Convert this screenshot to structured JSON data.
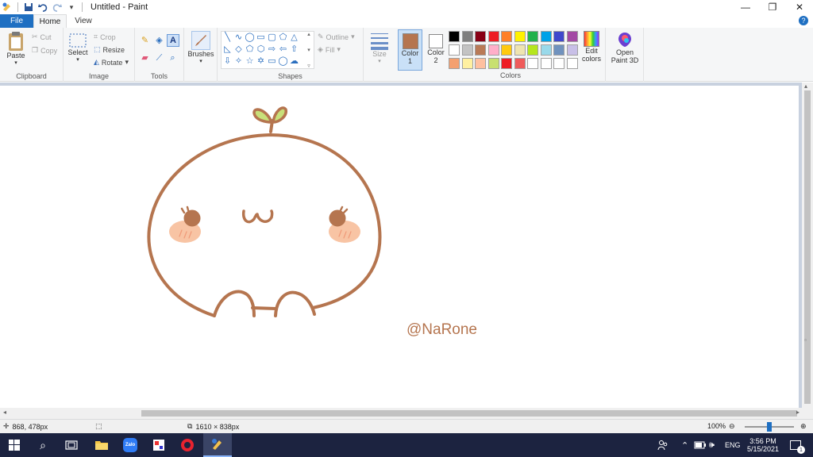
{
  "window": {
    "title": "Untitled - Paint"
  },
  "tabs": {
    "file": "File",
    "home": "Home",
    "view": "View"
  },
  "ribbon": {
    "clipboard": {
      "paste": "Paste",
      "cut": "Cut",
      "copy": "Copy",
      "label": "Clipboard"
    },
    "image": {
      "select": "Select",
      "crop": "Crop",
      "resize": "Resize",
      "rotate": "Rotate",
      "label": "Image"
    },
    "tools": {
      "label": "Tools"
    },
    "brushes": {
      "label": "Brushes"
    },
    "shapes": {
      "outline": "Outline",
      "fill": "Fill",
      "label": "Shapes"
    },
    "size": {
      "label": "Size"
    },
    "color1": {
      "label": "Color",
      "num": "1",
      "value": "#b5754f"
    },
    "color2": {
      "label": "Color",
      "num": "2",
      "value": "#ffffff"
    },
    "colors": {
      "label": "Colors"
    },
    "edit_colors": {
      "line1": "Edit",
      "line2": "colors"
    },
    "paint3d": {
      "line1": "Open",
      "line2": "Paint 3D"
    }
  },
  "palette": {
    "row1": [
      "#000000",
      "#7f7f7f",
      "#880015",
      "#ed1c24",
      "#ff7f27",
      "#fff200",
      "#22b14c",
      "#00a2e8",
      "#3f48cc",
      "#a349a4"
    ],
    "row2": [
      "#ffffff",
      "#c3c3c3",
      "#b97a57",
      "#ffaec9",
      "#ffc90e",
      "#efe4b0",
      "#b5e61d",
      "#99d9ea",
      "#7092be",
      "#c8bfe7"
    ],
    "row3": [
      "#f4a070",
      "#fff0a0",
      "#ffc0a0",
      "#c8e070",
      "#ee1c24",
      "#ef5b5b",
      "#ffffff",
      "#ffffff",
      "#ffffff",
      "#ffffff"
    ]
  },
  "canvas": {
    "signature": "@NaRone",
    "stroke_color": "#b5754f",
    "leaf_color": "#c8e07a",
    "blush_color": "#f8c4a4"
  },
  "status": {
    "cursor": "868, 478px",
    "size": "1610 × 838px",
    "zoom": "100%"
  },
  "taskbar": {
    "lang": "ENG",
    "time": "3:56 PM",
    "date": "5/15/2021",
    "notif": "1"
  }
}
